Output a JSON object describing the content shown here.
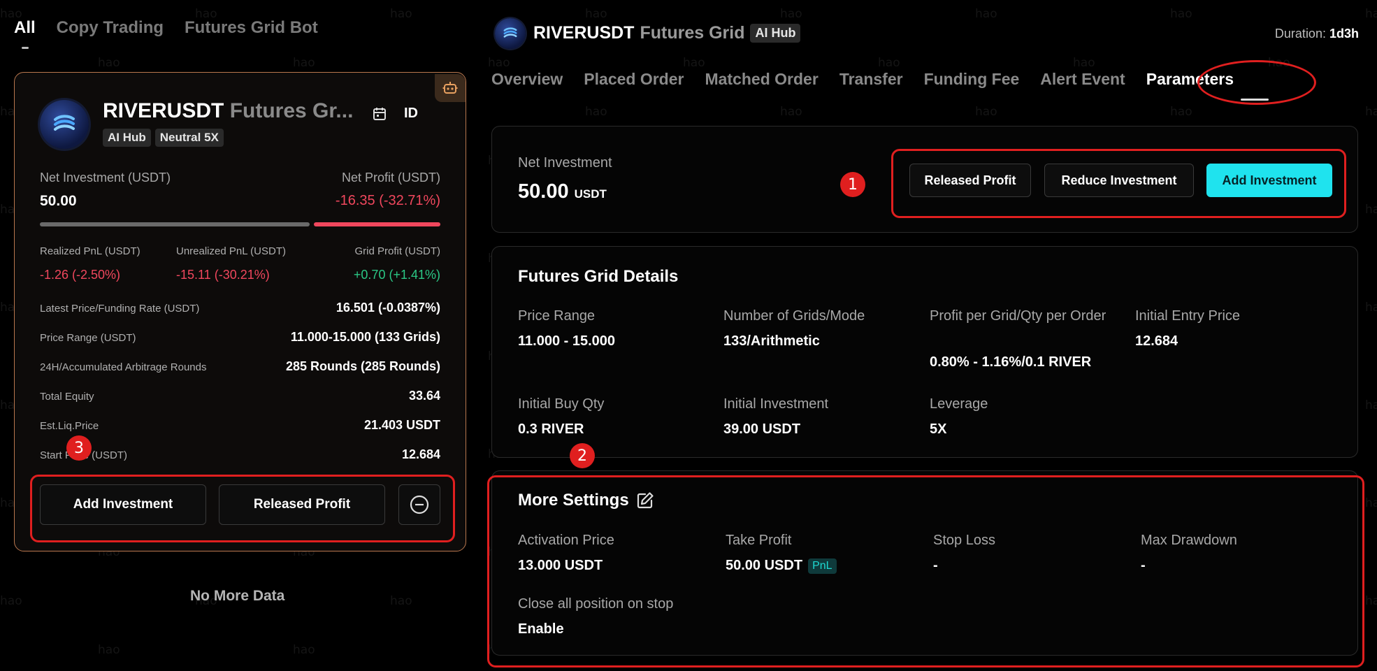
{
  "left": {
    "tabs": [
      "All",
      "Copy Trading",
      "Futures Grid Bot"
    ],
    "card": {
      "title": "RIVERUSDT",
      "title_sub": "Futures Gr...",
      "id_label": "ID",
      "badges": [
        "AI Hub",
        "Neutral 5X"
      ],
      "net_investment_label": "Net Investment (USDT)",
      "net_investment_value": "50.00",
      "net_profit_label": "Net Profit (USDT)",
      "net_profit_value": "-16.35 (-32.71%)",
      "realized_label": "Realized PnL (USDT)",
      "realized_value": "-1.26 (-2.50%)",
      "unrealized_label": "Unrealized PnL (USDT)",
      "unrealized_value": "-15.11 (-30.21%)",
      "grid_profit_label": "Grid Profit (USDT)",
      "grid_profit_value": "+0.70 (+1.41%)",
      "rows": [
        {
          "label": "Latest Price/Funding Rate (USDT)",
          "value": "16.501 (-0.0387%)"
        },
        {
          "label": "Price Range (USDT)",
          "value": "11.000-15.000 (133 Grids)"
        },
        {
          "label": "24H/Accumulated Arbitrage Rounds",
          "value": "285 Rounds (285 Rounds)"
        },
        {
          "label": "Total Equity",
          "value": "33.64"
        },
        {
          "label": "Est.Liq.Price",
          "value": "21.403 USDT"
        },
        {
          "label": "Start Price (USDT)",
          "value": "12.684"
        }
      ],
      "add_investment": "Add Investment",
      "released_profit": "Released Profit"
    },
    "no_more": "No More Data"
  },
  "right": {
    "title": "RIVERUSDT",
    "title_sub": "Futures Grid",
    "badge": "AI Hub",
    "duration_label": "Duration:",
    "duration_value": "1d3h",
    "tabs": [
      "Overview",
      "Placed Order",
      "Matched Order",
      "Transfer",
      "Funding Fee",
      "Alert Event",
      "Parameters"
    ],
    "net": {
      "label": "Net Investment",
      "value": "50.00",
      "unit": "USDT",
      "released_profit": "Released Profit",
      "reduce_investment": "Reduce Investment",
      "add_investment": "Add Investment"
    },
    "details": {
      "heading": "Futures Grid Details",
      "items": [
        {
          "label": "Price Range",
          "value": "11.000 - 15.000"
        },
        {
          "label": "Number of Grids/Mode",
          "value": "133/Arithmetic"
        },
        {
          "label": "Profit per Grid/Qty per Order",
          "value": "0.80% - 1.16%/0.1 RIVER"
        },
        {
          "label": "Initial Entry Price",
          "value": "12.684"
        },
        {
          "label": "Initial Buy Qty",
          "value": "0.3 RIVER"
        },
        {
          "label": "Initial Investment",
          "value": "39.00 USDT"
        },
        {
          "label": "Leverage",
          "value": "5X"
        }
      ]
    },
    "more": {
      "heading": "More Settings",
      "items": [
        {
          "label": "Activation Price",
          "value": "13.000 USDT"
        },
        {
          "label": "Take Profit",
          "value": "50.00 USDT",
          "badge": "PnL"
        },
        {
          "label": "Stop Loss",
          "value": "-"
        },
        {
          "label": "Max Drawdown",
          "value": "-"
        },
        {
          "label": "Close all position on stop",
          "value": "Enable"
        }
      ]
    }
  },
  "annotations": [
    "1",
    "2",
    "3"
  ],
  "watermark": "hao",
  "colors": {
    "profit_red": "#f0475d",
    "profit_green": "#2bc886",
    "accent_cyan": "#1fe3ee",
    "annotation_red": "#e01f1f",
    "card_border": "#b9774e"
  }
}
